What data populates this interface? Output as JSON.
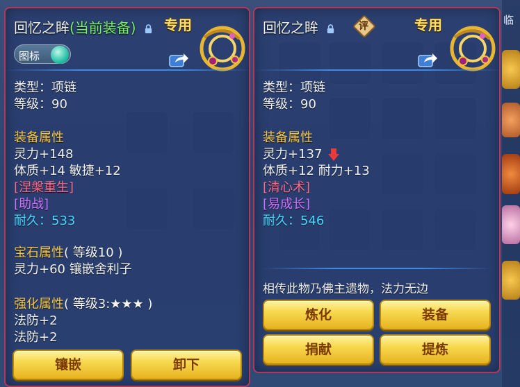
{
  "left_panel": {
    "title": "回忆之眸",
    "title_current": "(当前装备)",
    "badge": "专用",
    "toggle_label": "图标",
    "type_line": "类型：项链",
    "level_line": "等级：90",
    "equip_attr_header": "装备属性",
    "attr_lines": [
      "灵力+148",
      "体质+14 敏捷+12"
    ],
    "special_skill": "[涅槃重生]",
    "special_effect": "[助战]",
    "durability_label": "耐久：",
    "durability_value": "533",
    "gem_header": "宝石属性",
    "gem_level": "( 等级10 )",
    "gem_line": "灵力+60 镶嵌舍利子",
    "enhance_header": "强化属性",
    "enhance_level": "( 等级3:★★★ )",
    "enhance_lines": [
      "法防+2",
      "法防+2"
    ],
    "btn_inlay": "镶嵌",
    "btn_unequip": "卸下"
  },
  "right_panel": {
    "title": "回忆之眸",
    "eval": "评",
    "badge": "专用",
    "type_line": "类型：项链",
    "level_line": "等级：90",
    "equip_attr_header": "装备属性",
    "attr_line_1": "灵力+137",
    "attr_line_2": "体质+12 耐力+13",
    "special_skill": "[清心术]",
    "special_effect": "[易成长]",
    "durability_label": "耐久：",
    "durability_value": "546",
    "description": "相传此物乃佛主遗物，法力无边",
    "btn_refine": "炼化",
    "btn_equip": "装备",
    "btn_donate": "捐献",
    "btn_extract": "提炼"
  },
  "side": {
    "label": "临"
  },
  "colors": {
    "gold": "#f6c544",
    "red_skill": "#ff6a8a",
    "violet": "#d070ff",
    "cyan": "#47d8ff",
    "current_green": "#7af26a",
    "panel_border": "#b2385a"
  }
}
